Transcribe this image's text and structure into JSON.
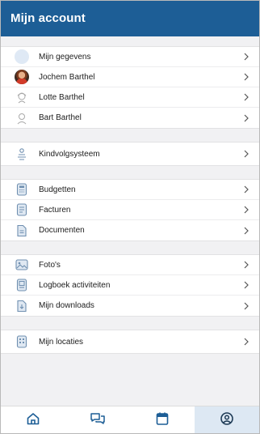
{
  "header": {
    "title": "Mijn account"
  },
  "groups": [
    {
      "items": [
        {
          "label": "Mijn gegevens",
          "icon": "profile-placeholder-icon"
        },
        {
          "label": "Jochem Barthel",
          "icon": "child-photo-avatar"
        },
        {
          "label": "Lotte Barthel",
          "icon": "child-girl-icon"
        },
        {
          "label": "Bart Barthel",
          "icon": "child-boy-icon"
        }
      ]
    },
    {
      "items": [
        {
          "label": "Kindvolgsysteem",
          "icon": "child-tracking-icon"
        }
      ]
    },
    {
      "items": [
        {
          "label": "Budgetten",
          "icon": "budget-icon"
        },
        {
          "label": "Facturen",
          "icon": "invoice-icon"
        },
        {
          "label": "Documenten",
          "icon": "document-icon"
        }
      ]
    },
    {
      "items": [
        {
          "label": "Foto's",
          "icon": "photo-icon"
        },
        {
          "label": "Logboek activiteiten",
          "icon": "logbook-icon"
        },
        {
          "label": "Mijn downloads",
          "icon": "download-icon"
        }
      ]
    },
    {
      "items": [
        {
          "label": "Mijn locaties",
          "icon": "location-building-icon"
        }
      ]
    }
  ],
  "tabbar": {
    "tabs": [
      {
        "name": "home",
        "icon": "home-icon"
      },
      {
        "name": "messages",
        "icon": "chat-icon"
      },
      {
        "name": "calendar",
        "icon": "calendar-icon"
      },
      {
        "name": "account",
        "icon": "account-icon",
        "active": true
      }
    ]
  },
  "colors": {
    "header": "#1d5e96",
    "icon": "#6f8fb0",
    "active_tab": "#dde8f3",
    "tab_icon": "#1d5e96"
  }
}
